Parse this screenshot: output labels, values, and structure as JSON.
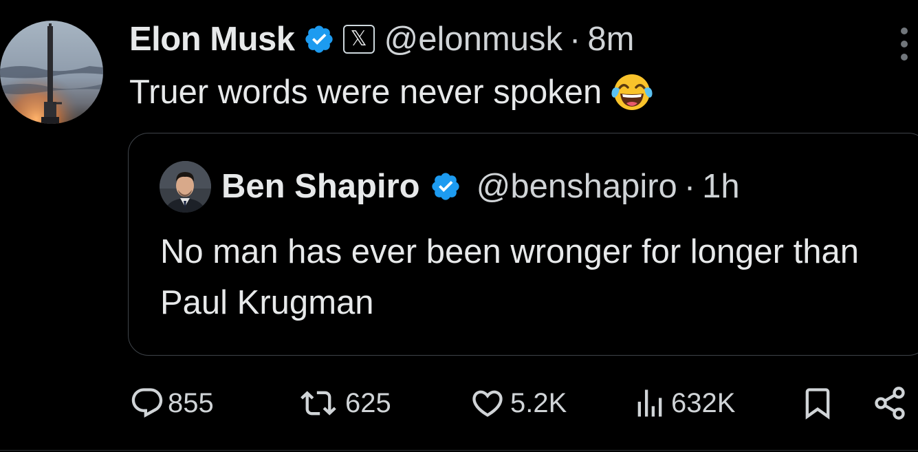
{
  "colors": {
    "background": "#000000",
    "text_primary": "#e7e9ea",
    "text_secondary": "#d0d4d7",
    "verified_blue": "#1d9bf0",
    "border": "#3f444a"
  },
  "post": {
    "author_name": "Elon Musk",
    "verified_icon": "verified-badge-icon",
    "affiliation_icon": "x-logo-icon",
    "affiliation_glyph": "𝕏",
    "handle": "@elonmusk",
    "separator": "·",
    "time": "8m",
    "more_icon": "more-vertical-icon",
    "text": "Truer words were never spoken",
    "emoji_icon": "face-with-tears-of-joy-icon"
  },
  "quoted_post": {
    "author_name": "Ben Shapiro",
    "verified_icon": "verified-badge-icon",
    "handle": "@benshapiro",
    "separator": "·",
    "time": "1h",
    "text": "No man has ever been wronger for longer than Paul Krugman"
  },
  "actions": {
    "replies": {
      "icon": "reply-icon",
      "count": "855"
    },
    "reposts": {
      "icon": "repost-icon",
      "count": "625"
    },
    "likes": {
      "icon": "heart-icon",
      "count": "5.2K"
    },
    "views": {
      "icon": "views-chart-icon",
      "count": "632K"
    },
    "bookmark": {
      "icon": "bookmark-icon"
    },
    "share": {
      "icon": "share-icon"
    }
  }
}
